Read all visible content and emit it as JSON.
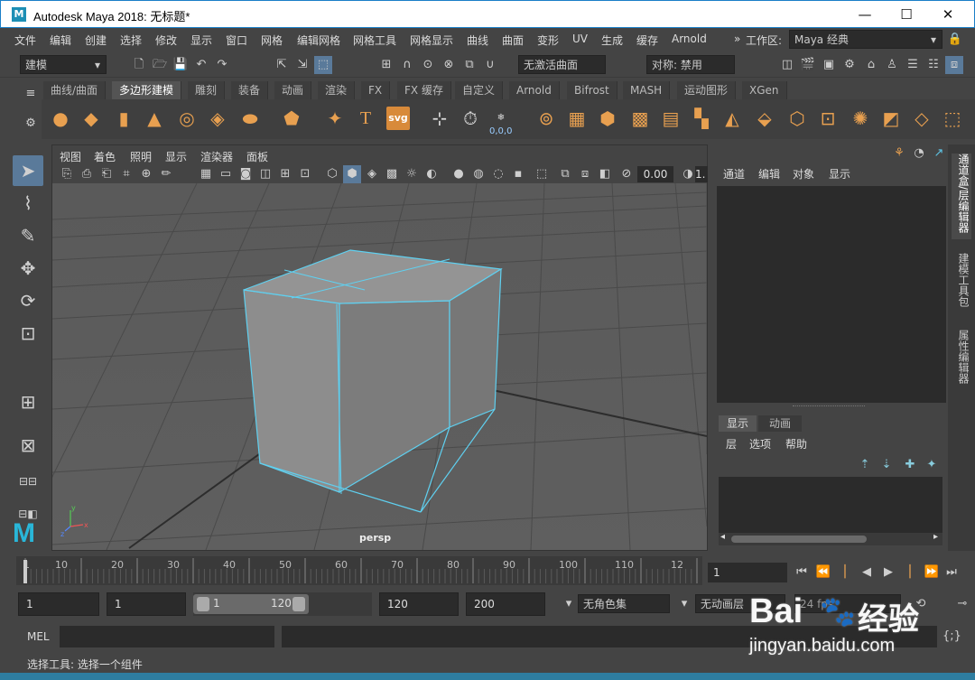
{
  "window": {
    "title": "Autodesk Maya 2018: 无标题*",
    "logo_letter": "M",
    "minimize": "—",
    "maximize": "☐",
    "close": "✕"
  },
  "menubar": {
    "items": [
      "文件",
      "编辑",
      "创建",
      "选择",
      "修改",
      "显示",
      "窗口",
      "网格",
      "编辑网格",
      "网格工具",
      "网格显示",
      "曲线",
      "曲面",
      "变形",
      "UV",
      "生成",
      "缓存",
      "Arnold"
    ],
    "workspace_label": "工作区:",
    "workspace_value": "Maya 经典",
    "chevron": "»"
  },
  "statusline": {
    "mode": "建模",
    "live_surface": "无激活曲面",
    "symmetry": "对称: 禁用"
  },
  "shelf": {
    "tabs": [
      "曲线/曲面",
      "多边形建模",
      "雕刻",
      "装备",
      "动画",
      "渲染",
      "FX",
      "FX 缓存",
      "自定义",
      "Arnold",
      "Bifrost",
      "MASH",
      "运动图形",
      "XGen"
    ],
    "active_tab": "多边形建模",
    "icons": [
      "sphere-icon",
      "cube-icon",
      "cylinder-icon",
      "cone-icon",
      "torus-icon",
      "plane-icon",
      "disc-icon",
      "platonic-icon",
      "super-shape-icon",
      "type-icon",
      "svg-icon",
      "measure-icon",
      "tool-x-icon",
      "coords-icon",
      "combine-icon",
      "separate-icon",
      "smooth-icon",
      "bevel-icon",
      "bridge-icon",
      "extrude-icon",
      "append-icon",
      "fill-hole-icon",
      "merge-icon",
      "multi-cut-icon",
      "target-weld-icon",
      "quad-draw-icon",
      "edge-loop-icon"
    ],
    "type_label": "T",
    "svg_label": "svg",
    "coords_label": "0,0,0"
  },
  "viewport": {
    "menu": [
      "视图",
      "着色",
      "照明",
      "显示",
      "渲染器",
      "面板"
    ],
    "camera_label": "persp",
    "exposure": "0.00",
    "gamma": "1."
  },
  "channelbox": {
    "menu": [
      "通道",
      "编辑",
      "对象",
      "显示"
    ]
  },
  "layers": {
    "tabs": [
      "显示",
      "动画"
    ],
    "active_tab": "显示",
    "menu": [
      "层",
      "选项",
      "帮助"
    ]
  },
  "sidetabs": [
    "通道盒/层编辑器",
    "建模工具包",
    "属性编辑器"
  ],
  "timeline": {
    "ticks": [
      "1",
      "10",
      "20",
      "30",
      "40",
      "50",
      "60",
      "70",
      "80",
      "90",
      "100",
      "110",
      "12"
    ],
    "current_frame": "1"
  },
  "range": {
    "start": "1",
    "playback_start": "1",
    "slider_start": "1",
    "slider_end": "120",
    "playback_end": "120",
    "end": "200",
    "character_set": "无角色集",
    "anim_layer": "无动画层",
    "fps": "24 fps"
  },
  "commandline": {
    "language": "MEL"
  },
  "helpline": {
    "text": "选择工具: 选择一个组件"
  },
  "watermark": {
    "brand": "Bai",
    "brand_cn": "经验",
    "url": "jingyan.baidu.com"
  },
  "colors": {
    "accent": "#5fc6e8",
    "shelf_icon": "#e8a050",
    "background": "#444444"
  }
}
